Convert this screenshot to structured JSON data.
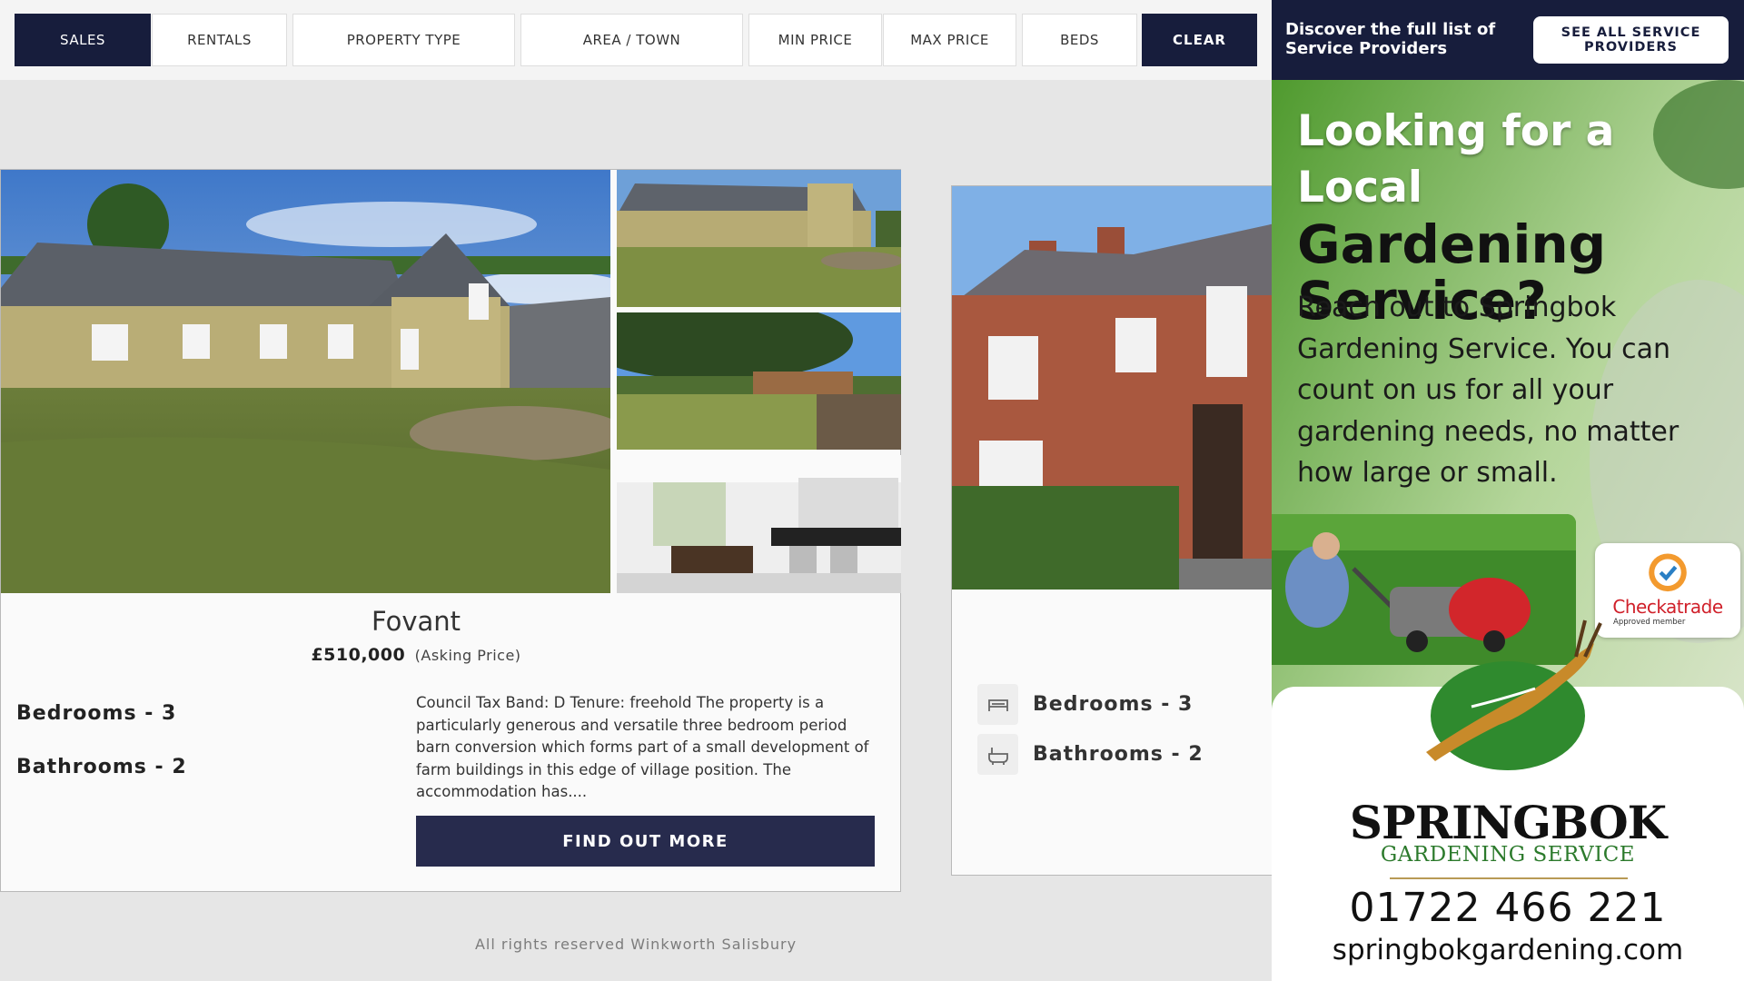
{
  "filters": {
    "sales": "SALES",
    "rentals": "RENTALS",
    "property_type": "PROPERTY TYPE",
    "area_town": "AREA / TOWN",
    "min_price": "MIN PRICE",
    "max_price": "MAX PRICE",
    "beds": "BEDS",
    "clear": "CLEAR",
    "active": "SALES"
  },
  "listing1": {
    "title": "Fovant",
    "price": "£510,000",
    "price_qualifier": "(Asking Price)",
    "bedrooms": "Bedrooms - 3",
    "bathrooms": "Bathrooms - 2",
    "description": "Council Tax Band: D Tenure: freehold The property is a particularly generous and versatile three bedroom period barn conversion which forms part of a small development of farm buildings in this edge of village position. The accommodation has....",
    "cta": "FIND OUT MORE",
    "photos": [
      "barn-conversion-exterior",
      "barn-exterior-side",
      "garden-view",
      "kitchen-interior"
    ]
  },
  "listing2": {
    "bedrooms": "Bedrooms - 3",
    "bathrooms": "Bathrooms - 2",
    "icons": [
      "bed-icon",
      "bath-icon"
    ],
    "photos": [
      "brick-terraced-house"
    ]
  },
  "footer": {
    "text": "All rights reserved Winkworth Salisbury"
  },
  "sidebar": {
    "header_text": "Discover the full list of Service Providers",
    "see_all": "SEE ALL SERVICE PROVIDERS",
    "ad": {
      "headline_1": "Looking for a Local",
      "headline_2": "Gardening",
      "headline_3": "Service?",
      "body": "Reach out to Springbok Gardening Service. You can count on us for all your gardening needs, no matter how large or small.",
      "badge_name": "Checkatrade",
      "badge_sub": "Approved member",
      "brand": "SPRINGBOK",
      "brand_sub": "GARDENING SERVICE",
      "phone": "01722 466 221",
      "website": "springbokgardening.com"
    }
  },
  "colors": {
    "navy": "#171d3c",
    "button_navy": "#272b4d",
    "page_bg": "#e6e6e6",
    "ad_green": "#4f9a2e"
  }
}
